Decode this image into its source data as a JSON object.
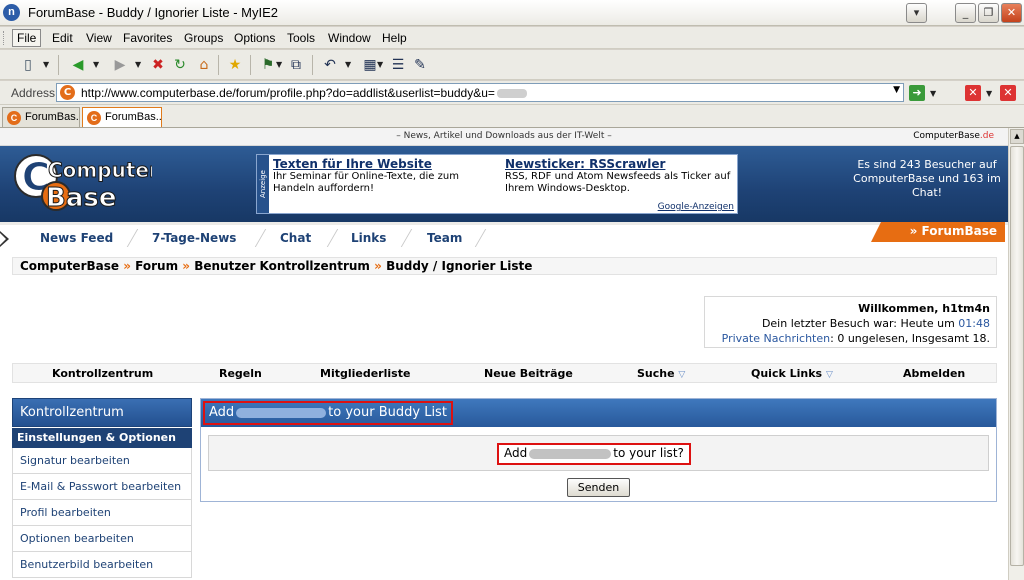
{
  "window": {
    "title": "ForumBase - Buddy / Ignorier Liste - MyIE2",
    "app_icon": "n"
  },
  "menu": [
    "File",
    "Edit",
    "View",
    "Favorites",
    "Groups",
    "Options",
    "Tools",
    "Window",
    "Help"
  ],
  "toolbar": {
    "icons": [
      "new-page-icon",
      "back-icon",
      "forward-icon",
      "stop-icon",
      "refresh-icon",
      "home-icon",
      "favorites-star-icon",
      "groups-icon",
      "window-icon",
      "undo-icon",
      "view-icon",
      "list-icon",
      "edit-icon"
    ]
  },
  "address": {
    "label": "Address",
    "url": "http://www.computerbase.de/forum/profile.php?do=addlist&userlist=buddy&u="
  },
  "tabs": [
    {
      "label": "ForumBas..."
    },
    {
      "label": "ForumBas..."
    }
  ],
  "site": {
    "slogan": "– News, Artikel und Downloads aus der IT-Welt –",
    "brand": "ComputerBase",
    "brand_tld": ".de",
    "logo_line1": "Computer",
    "logo_line2": "Base",
    "ad_label": "Anzeige",
    "ads": [
      {
        "title": "Texten für Ihre Website",
        "text": "Ihr Seminar für Online-Texte, die zum Handeln auffordern!"
      },
      {
        "title": "Newsticker: RSScrawler",
        "text": "RSS, RDF und Atom Newsfeeds als Ticker auf Ihrem Windows-Desktop."
      }
    ],
    "google_ads": "Google-Anzeigen",
    "visitors": "Es sind 243 Besucher auf ComputerBase und 163 im Chat!"
  },
  "nav": {
    "links": [
      "News Feed",
      "7-Tage-News",
      "Chat",
      "Links",
      "Team"
    ],
    "forumbase": "» ForumBase"
  },
  "breadcrumb": {
    "items": [
      "ComputerBase",
      "Forum",
      "Benutzer Kontrollzentrum",
      "Buddy / Ignorier Liste"
    ],
    "sep": "»"
  },
  "welcome": {
    "title": "Willkommen, h1tm4n",
    "last_visit_prefix": "Dein letzter Besuch war: Heute um",
    "last_visit_time": "01:48",
    "pm_link": "Private Nachrichten",
    "pm_text": ": 0 ungelesen, Insgesamt 18."
  },
  "main_nav": [
    "Kontrollzentrum",
    "Regeln",
    "Mitgliederliste",
    "Neue Beiträge",
    "Suche",
    "Quick Links",
    "Abmelden"
  ],
  "sidebar": {
    "title": "Kontrollzentrum",
    "section": "Einstellungen & Optionen",
    "items": [
      "Signatur bearbeiten",
      "E-Mail & Passwort bearbeiten",
      "Profil bearbeiten",
      "Optionen bearbeiten",
      "Benutzerbild bearbeiten"
    ]
  },
  "panel": {
    "title_prefix": "Add",
    "title_suffix": "to your Buddy List",
    "question_prefix": "Add",
    "question_suffix": "to your list?",
    "submit": "Senden"
  },
  "colors": {
    "accent_orange": "#e76d12",
    "header_blue": "#1e4275",
    "highlight_red": "#dd1111"
  }
}
